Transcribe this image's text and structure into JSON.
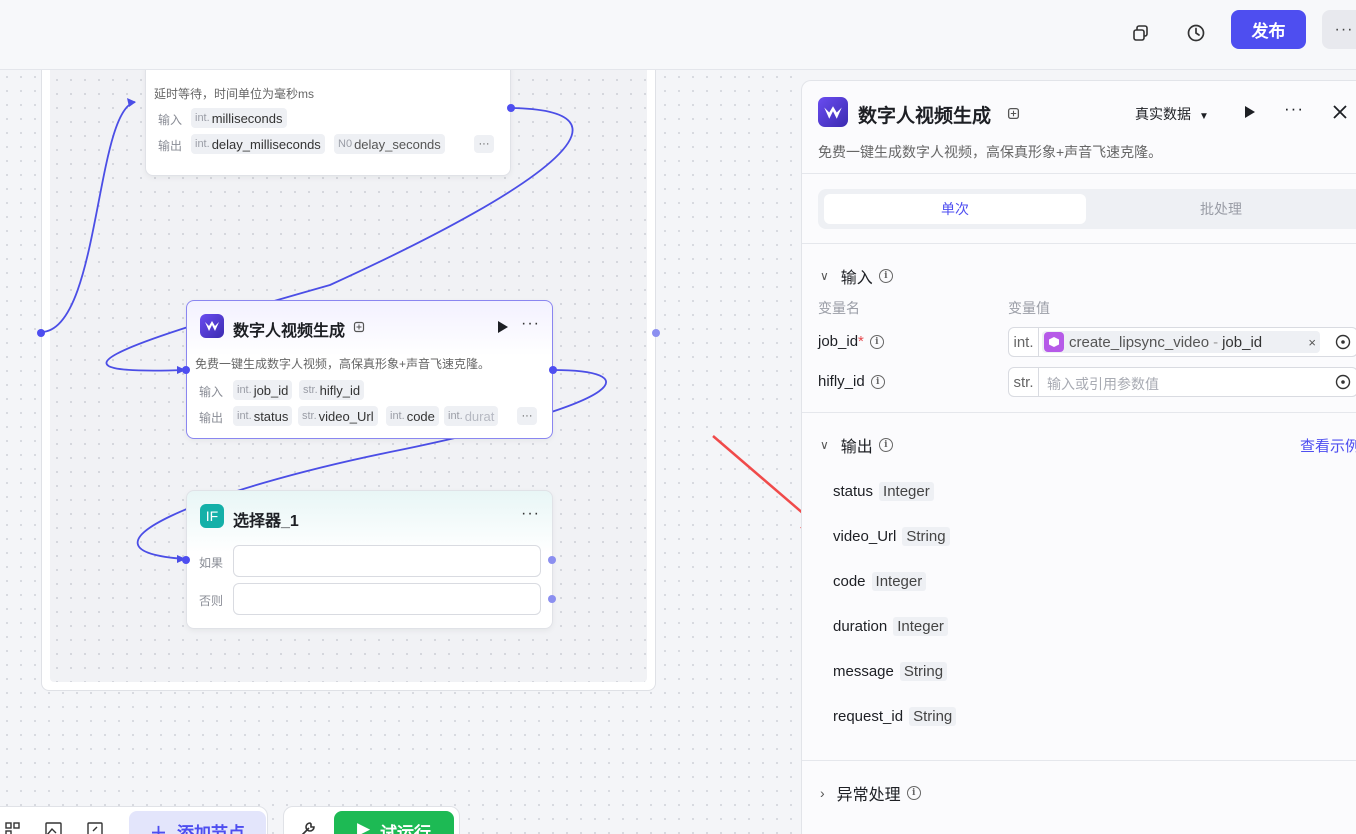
{
  "topbar": {
    "publish_label": "发布",
    "more_label": "···",
    "icons": [
      "copy-icon",
      "history-icon"
    ]
  },
  "nodes": {
    "delay": {
      "description": "延时等待，时间单位为毫秒ms",
      "input_label": "输入",
      "output_label": "输出",
      "inputs": [
        {
          "type": "int.",
          "name": "milliseconds"
        }
      ],
      "outputs": [
        {
          "type": "int.",
          "name": "delay_milliseconds"
        },
        {
          "type": "N0",
          "name": "delay_seconds"
        }
      ]
    },
    "digital_human": {
      "title": "数字人视频生成",
      "description": "免费一键生成数字人视频，高保真形象+声音飞速克隆。",
      "input_label": "输入",
      "output_label": "输出",
      "inputs": [
        {
          "type": "int.",
          "name": "job_id"
        },
        {
          "type": "str.",
          "name": "hifly_id"
        }
      ],
      "outputs": [
        {
          "type": "int.",
          "name": "status"
        },
        {
          "type": "str.",
          "name": "video_Url"
        },
        {
          "type": "int.",
          "name": "code"
        },
        {
          "type": "int.",
          "name": "durat"
        }
      ]
    },
    "selector": {
      "title": "选择器_1",
      "icon_text": "IF",
      "if_label": "如果",
      "else_label": "否则"
    }
  },
  "bottom": {
    "add_node_label": "添加节点",
    "run_label": "试运行"
  },
  "panel": {
    "title": "数字人视频生成",
    "data_mode": "真实数据",
    "description": "免费一键生成数字人视频，高保真形象+声音飞速克隆。",
    "tabs": [
      "单次",
      "批处理"
    ],
    "input_section": "输入",
    "col_name": "变量名",
    "col_value": "变量值",
    "inputs": [
      {
        "name": "job_id",
        "required": "*",
        "type": "int.",
        "ref_node": "create_lipsync_video",
        "ref_sep": "-",
        "ref_field": "job_id"
      },
      {
        "name": "hifly_id",
        "type": "str.",
        "placeholder": "输入或引用参数值"
      }
    ],
    "output_section": "输出",
    "view_example": "查看示例",
    "outputs": [
      {
        "name": "status",
        "type": "Integer"
      },
      {
        "name": "video_Url",
        "type": "String"
      },
      {
        "name": "code",
        "type": "Integer"
      },
      {
        "name": "duration",
        "type": "Integer"
      },
      {
        "name": "message",
        "type": "String"
      },
      {
        "name": "request_id",
        "type": "String"
      }
    ],
    "exception_section": "异常处理"
  },
  "colors": {
    "accent": "#4e4ef0",
    "run_green": "#1dba54",
    "arrow_red": "#f04a4a"
  }
}
